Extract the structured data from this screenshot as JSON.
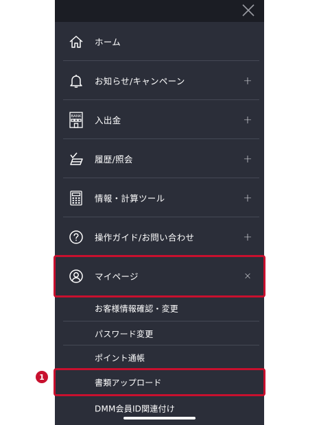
{
  "colors": {
    "panel_bg": "#2b2e39",
    "topbar_bg": "#1b1d24",
    "divider": "#454955",
    "highlight": "#c8102e",
    "text": "#ffffff"
  },
  "menu": {
    "items": [
      {
        "label": "ホーム",
        "icon": "home-icon",
        "toggle": ""
      },
      {
        "label": "お知らせ/キャンペーン",
        "icon": "bell-icon",
        "toggle": "+"
      },
      {
        "label": "入出金",
        "icon": "bank-icon",
        "toggle": "+"
      },
      {
        "label": "履歴/照会",
        "icon": "history-check-icon",
        "toggle": "+"
      },
      {
        "label": "情報・計算ツール",
        "icon": "calculator-icon",
        "toggle": "+"
      },
      {
        "label": "操作ガイド/お問い合わせ",
        "icon": "question-circle-icon",
        "toggle": "+"
      },
      {
        "label": "マイページ",
        "icon": "user-circle-icon",
        "toggle": "×"
      }
    ],
    "bank_icon_text": "BANK"
  },
  "submenu": {
    "items": [
      {
        "label": "お客様情報確認・変更"
      },
      {
        "label": "パスワード変更"
      },
      {
        "label": "ポイント通帳"
      },
      {
        "label": "書類アップロード"
      },
      {
        "label": "DMM会員ID関連付け"
      }
    ]
  },
  "annotation": {
    "step_number": "1"
  }
}
